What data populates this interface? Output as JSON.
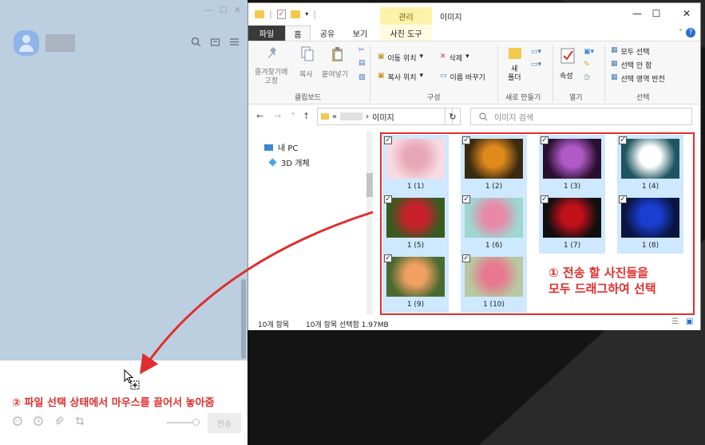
{
  "chat": {
    "win_controls": [
      "—",
      "☐",
      "✕"
    ],
    "tool_icons": [
      "search-icon",
      "archive-icon",
      "menu-icon"
    ],
    "bottom_icons": [
      "emoji-icon",
      "schedule-icon",
      "attach-icon",
      "crop-icon"
    ],
    "send_label": "전송"
  },
  "explorer": {
    "tab_manage": "관리",
    "window_title": "이미지",
    "tabs": {
      "file": "파일",
      "home": "홈",
      "share": "공유",
      "view": "보기",
      "picture_tools": "사진 도구"
    },
    "ribbon": {
      "pin": "즐겨찾기에\n고정",
      "copy": "복사",
      "paste": "붙여넣기",
      "move_to": "이동 위치",
      "copy_to": "복사 위치",
      "delete": "삭제",
      "rename": "이름 바꾸기",
      "new_folder": "새\n폴더",
      "properties": "속성",
      "select_all": "모두 선택",
      "select_none": "선택 안 함",
      "invert": "선택 영역 반전",
      "groups": {
        "clipboard": "클립보드",
        "organize": "구성",
        "new": "새로 만들기",
        "open": "열기",
        "select": "선택"
      }
    },
    "address": {
      "prefix": "«",
      "folder": "이미지",
      "search_placeholder": "이미지 검색"
    },
    "tree": {
      "pc": "내 PC",
      "objects3d": "3D 개체"
    },
    "files": [
      {
        "name": "1 (1)",
        "colors": [
          "#e8a7b8",
          "#f7dbe0"
        ]
      },
      {
        "name": "1 (2)",
        "colors": [
          "#e08a1e",
          "#3a2a10"
        ]
      },
      {
        "name": "1 (3)",
        "colors": [
          "#b05ac8",
          "#2a1030"
        ]
      },
      {
        "name": "1 (4)",
        "colors": [
          "#ffffff",
          "#1d5560"
        ]
      },
      {
        "name": "1 (5)",
        "colors": [
          "#c8202a",
          "#3a5a20"
        ]
      },
      {
        "name": "1 (6)",
        "colors": [
          "#e889a8",
          "#9fd6d0"
        ]
      },
      {
        "name": "1 (7)",
        "colors": [
          "#c0101a",
          "#101010"
        ]
      },
      {
        "name": "1 (8)",
        "colors": [
          "#1a3ed0",
          "#0a1540"
        ]
      },
      {
        "name": "1 (9)",
        "colors": [
          "#f0a060",
          "#4a6a30"
        ]
      },
      {
        "name": "1 (10)",
        "colors": [
          "#e87890",
          "#b8c8a0"
        ]
      }
    ],
    "status": {
      "count": "10개 항목",
      "selected": "10개 항목 선택함 1.97MB"
    }
  },
  "annotations": {
    "step1_line1": "① 전송 할 사진들을",
    "step1_line2": "모두 드래그하여 선택",
    "step2": "② 파일 선택 상태에서 마우스를 끌어서 놓아줌",
    "accent_color": "#e02e2e"
  }
}
